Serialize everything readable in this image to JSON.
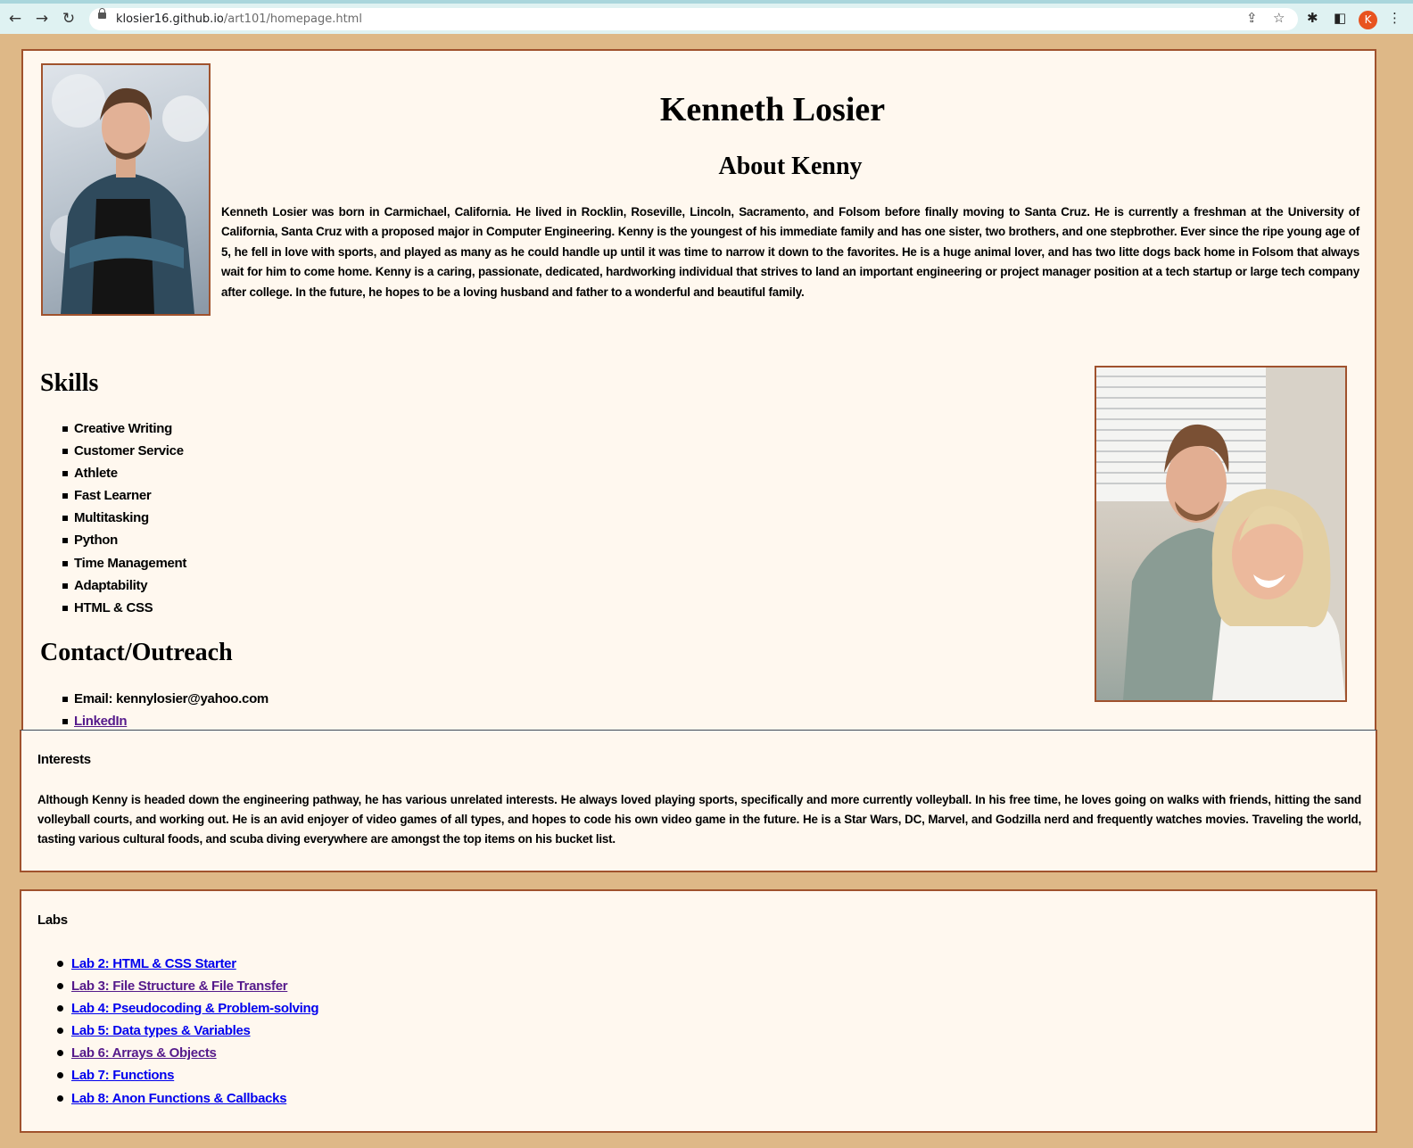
{
  "browser": {
    "url_host": "klosier16.github.io",
    "url_path": "/art101/homepage.html",
    "profile_initial": "K",
    "icons": [
      "back-arrow-icon",
      "forward-arrow-icon",
      "reload-icon",
      "lock-icon",
      "share-icon",
      "star-icon",
      "extensions-icon",
      "side-panel-icon",
      "menu-icon"
    ]
  },
  "header": {
    "name": "Kenneth Losier",
    "about_title": "About Kenny"
  },
  "bio": "Kenneth Losier was born in Carmichael, California. He lived in Rocklin, Roseville, Lincoln, Sacramento, and Folsom before finally moving to Santa Cruz. He is currently a freshman at the University of California, Santa Cruz with a proposed major in Computer Engineering. Kenny is the youngest of his immediate family and has one sister, two brothers, and one stepbrother. Ever since the ripe young age of 5, he fell in love with sports, and played as many as he could handle up until it was time to narrow it down to the favorites. He is a huge animal lover, and has two litte dogs back home in Folsom that always wait for him to come home. Kenny is a caring, passionate, dedicated, hardworking individual that strives to land an important engineering or project manager position at a tech startup or large tech company after college. In the future, he hopes to be a loving husband and father to a wonderful and beautiful family.",
  "skills": {
    "title": "Skills",
    "items": [
      "Creative Writing",
      "Customer Service",
      "Athlete",
      "Fast Learner",
      "Multitasking",
      "Python",
      "Time Management",
      "Adaptability",
      "HTML & CSS"
    ]
  },
  "contact": {
    "title": "Contact/Outreach",
    "email": "Email: kennylosier@yahoo.com",
    "linkedin": "LinkedIn"
  },
  "interests": {
    "title": "Interests",
    "text": "Although Kenny is headed down the engineering pathway, he has various unrelated interests. He always loved playing sports, specifically and more currently volleyball. In his free time, he loves going on walks with friends, hitting the sand volleyball courts, and working out. He is an avid enjoyer of video games of all types, and hopes to code his own video game in the future. He is a Star Wars, DC, Marvel, and Godzilla nerd and frequently watches movies. Traveling the world, tasting various cultural foods, and scuba diving everywhere are amongst the top items on his bucket list."
  },
  "labs": {
    "title": "Labs",
    "items": [
      {
        "label": "Lab 2: HTML & CSS Starter",
        "visited": false
      },
      {
        "label": "Lab 3: File Structure & File Transfer",
        "visited": true
      },
      {
        "label": "Lab 4: Pseudocoding & Problem-solving",
        "visited": false
      },
      {
        "label": "Lab 5: Data types & Variables",
        "visited": false
      },
      {
        "label": "Lab 6: Arrays & Objects",
        "visited": true
      },
      {
        "label": "Lab 7: Functions",
        "visited": false
      },
      {
        "label": "Lab 8: Anon Functions & Callbacks",
        "visited": false
      }
    ]
  },
  "colors": {
    "page_background": "#deb887",
    "panel_background": "#fff8ef",
    "panel_border": "#a0522d",
    "link_unvisited": "#0000ee",
    "link_visited": "#551a8b"
  }
}
